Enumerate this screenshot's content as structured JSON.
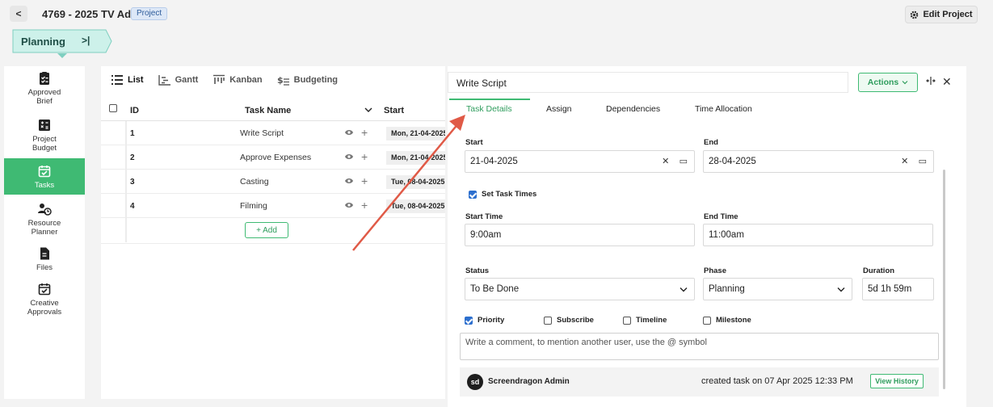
{
  "header": {
    "back_label": "<",
    "project_title": "4769 - 2025 TV Ad",
    "project_badge": "Project",
    "edit_label": "Edit Project"
  },
  "phase": {
    "label": "Planning",
    "toggle_icon": ">|"
  },
  "nav": {
    "items": [
      {
        "label": "Approved\nBrief",
        "icon": "brief-icon"
      },
      {
        "label": "Project\nBudget",
        "icon": "budget-icon"
      },
      {
        "label": "Tasks",
        "icon": "tasks-icon",
        "active": true
      },
      {
        "label": "Resource\nPlanner",
        "icon": "resource-planner-icon"
      },
      {
        "label": "Files",
        "icon": "files-icon"
      },
      {
        "label": "Creative\nApprovals",
        "icon": "creative-approvals-icon"
      }
    ]
  },
  "views": {
    "tabs": [
      {
        "label": "List",
        "active": true
      },
      {
        "label": "Gantt"
      },
      {
        "label": "Kanban"
      },
      {
        "label": "Budgeting"
      }
    ]
  },
  "table": {
    "columns": {
      "id": "ID",
      "name": "Task Name",
      "start": "Start"
    },
    "rows": [
      {
        "id": "1",
        "name": "Write Script",
        "start": "Mon, 21-04-2025"
      },
      {
        "id": "2",
        "name": "Approve Expenses",
        "start": "Mon, 21-04-2025"
      },
      {
        "id": "3",
        "name": "Casting",
        "start": "Tue, 08-04-2025"
      },
      {
        "id": "4",
        "name": "Filming",
        "start": "Tue, 08-04-2025"
      }
    ],
    "add_label": "+ Add"
  },
  "detail": {
    "title": "Write Script",
    "actions_label": "Actions",
    "tabs": [
      "Task Details",
      "Assign",
      "Dependencies",
      "Time Allocation"
    ],
    "start_label": "Start",
    "start_value": "21-04-2025",
    "end_label": "End",
    "end_value": "28-04-2025",
    "set_times_label": "Set Task Times",
    "start_time_label": "Start Time",
    "start_time_value": "9:00am",
    "end_time_label": "End Time",
    "end_time_value": "11:00am",
    "status_label": "Status",
    "status_value": "To Be Done",
    "phase_label": "Phase",
    "phase_value": "Planning",
    "duration_label": "Duration",
    "duration_value": "5d 1h 59m",
    "checks": [
      {
        "label": "Priority",
        "checked": true
      },
      {
        "label": "Subscribe",
        "checked": false
      },
      {
        "label": "Timeline",
        "checked": false
      },
      {
        "label": "Milestone",
        "checked": false
      }
    ],
    "comment_placeholder": "Write a comment, to mention another user, use the @ symbol",
    "avatar_initials": "sd",
    "author": "Screendragon Admin",
    "created_text": "created task on  07 Apr 2025 12:33 PM",
    "history_label": "View History"
  },
  "colors": {
    "accent": "#3fba73",
    "arrow": "#e05a47",
    "checkbox": "#2d6fce"
  }
}
